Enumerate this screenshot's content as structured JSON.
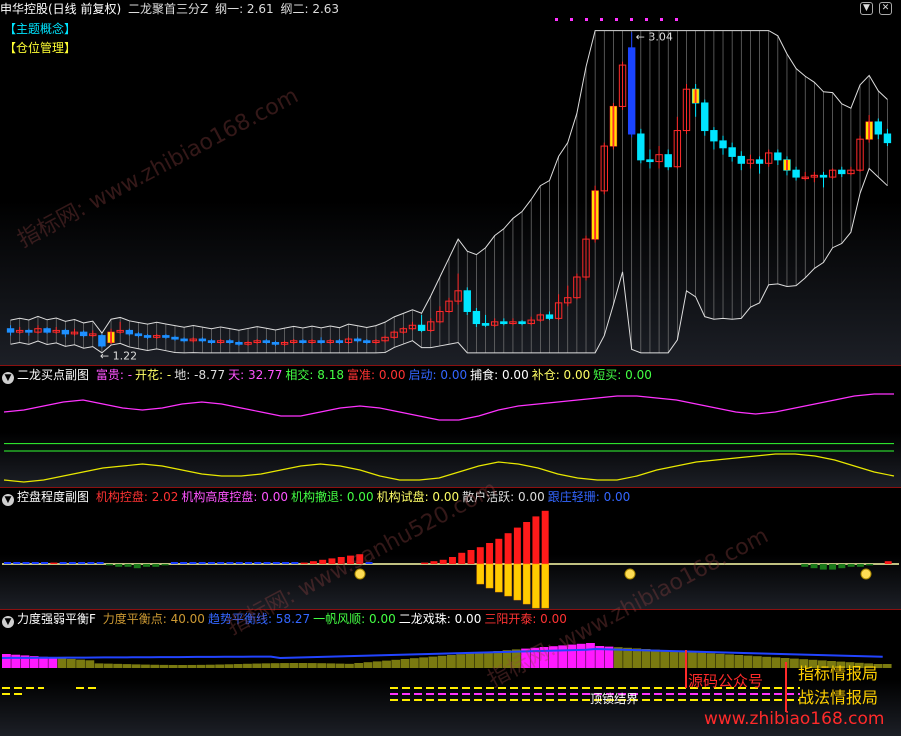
{
  "main": {
    "title": "申华控股(日线 前复权)",
    "indicator": "二龙聚首三分Z",
    "net1_label": "纲一: 2.61",
    "net2_label": "纲二: 2.63",
    "tags": [
      "【主题概念】",
      "【仓位管理】"
    ],
    "high_label": "3.04",
    "low_label": "1.22"
  },
  "p1": {
    "name": "二龙买点副图",
    "items": [
      {
        "label": "富贵: -",
        "color": "#ff55ff"
      },
      {
        "label": "开花: -",
        "color": "#ffff66"
      },
      {
        "label": "地: -8.77",
        "color": "#dddddd"
      },
      {
        "label": "天: 32.77",
        "color": "#ff55ff"
      },
      {
        "label": "相交: 8.18",
        "color": "#44ff44"
      },
      {
        "label": "富准: 0.00",
        "color": "#ff3333"
      },
      {
        "label": "启动: 0.00",
        "color": "#3366ff"
      },
      {
        "label": "捕食: 0.00",
        "color": "#ffffff"
      },
      {
        "label": "补仓: 0.00",
        "color": "#ffff66"
      },
      {
        "label": "短买: 0.00",
        "color": "#44ff44"
      }
    ]
  },
  "p2": {
    "name": "控盘程度副图",
    "items": [
      {
        "label": "机构控盘: 2.02",
        "color": "#ff3333"
      },
      {
        "label": "机构高度控盘: 0.00",
        "color": "#ff55ff"
      },
      {
        "label": "机构撤退: 0.00",
        "color": "#44ff44"
      },
      {
        "label": "机构试盘: 0.00",
        "color": "#ffff66"
      },
      {
        "label": "散户活跃: 0.00",
        "color": "#dddddd"
      },
      {
        "label": "跟庄轻珊: 0.00",
        "color": "#3366ff"
      }
    ]
  },
  "p3": {
    "name": "力度强弱平衡F",
    "items": [
      {
        "label": "力度平衡点: 40.00",
        "color": "#cc9933"
      },
      {
        "label": "趋势平衡线: 58.27",
        "color": "#3366ff"
      },
      {
        "label": "一帆风顺: 0.00",
        "color": "#44ff44"
      },
      {
        "label": "二龙戏珠: 0.00",
        "color": "#ffffff"
      },
      {
        "label": "三阳开泰: 0.00",
        "color": "#ff3333"
      }
    ],
    "signal_text": "顶锁结界",
    "promo1": "指标情报局",
    "promo2": "战法情报局",
    "promo3": "源码公众号",
    "url": "www.zhibiao168.com"
  },
  "watermarks": [
    "指标网: www.zhibiao168.com",
    "指标网: www.sanhu520.com",
    "指标网: www.zhibiao168.com"
  ],
  "chart_data": [
    {
      "type": "candlestick",
      "title": "申华控股(日线 前复权)",
      "note": "price series approximated, prices in yuan",
      "ylim": [
        1.15,
        3.1
      ],
      "candles": [
        [
          1.32,
          1.3,
          1.34,
          1.28
        ],
        [
          1.3,
          1.31,
          1.33,
          1.29
        ],
        [
          1.31,
          1.3,
          1.32,
          1.28
        ],
        [
          1.3,
          1.32,
          1.34,
          1.29
        ],
        [
          1.32,
          1.3,
          1.33,
          1.29
        ],
        [
          1.3,
          1.31,
          1.33,
          1.29
        ],
        [
          1.31,
          1.29,
          1.32,
          1.27
        ],
        [
          1.29,
          1.3,
          1.32,
          1.28
        ],
        [
          1.3,
          1.28,
          1.31,
          1.27
        ],
        [
          1.28,
          1.29,
          1.31,
          1.27
        ],
        [
          1.28,
          1.22,
          1.29,
          1.21
        ],
        [
          1.24,
          1.3,
          1.32,
          1.23
        ],
        [
          1.3,
          1.31,
          1.36,
          1.29
        ],
        [
          1.31,
          1.29,
          1.32,
          1.28
        ],
        [
          1.29,
          1.28,
          1.3,
          1.27
        ],
        [
          1.28,
          1.27,
          1.29,
          1.26
        ],
        [
          1.27,
          1.28,
          1.29,
          1.26
        ],
        [
          1.28,
          1.27,
          1.29,
          1.26
        ],
        [
          1.27,
          1.26,
          1.28,
          1.25
        ],
        [
          1.26,
          1.25,
          1.27,
          1.24
        ],
        [
          1.25,
          1.26,
          1.27,
          1.24
        ],
        [
          1.26,
          1.25,
          1.27,
          1.24
        ],
        [
          1.25,
          1.24,
          1.26,
          1.23
        ],
        [
          1.24,
          1.25,
          1.26,
          1.23
        ],
        [
          1.25,
          1.24,
          1.26,
          1.23
        ],
        [
          1.24,
          1.23,
          1.25,
          1.22
        ],
        [
          1.23,
          1.24,
          1.25,
          1.22
        ],
        [
          1.24,
          1.25,
          1.26,
          1.23
        ],
        [
          1.25,
          1.24,
          1.26,
          1.23
        ],
        [
          1.24,
          1.23,
          1.25,
          1.22
        ],
        [
          1.23,
          1.24,
          1.25,
          1.22
        ],
        [
          1.24,
          1.25,
          1.26,
          1.23
        ],
        [
          1.25,
          1.24,
          1.26,
          1.23
        ],
        [
          1.24,
          1.25,
          1.26,
          1.23
        ],
        [
          1.25,
          1.24,
          1.27,
          1.23
        ],
        [
          1.24,
          1.25,
          1.26,
          1.23
        ],
        [
          1.25,
          1.24,
          1.26,
          1.23
        ],
        [
          1.24,
          1.26,
          1.27,
          1.23
        ],
        [
          1.26,
          1.25,
          1.27,
          1.24
        ],
        [
          1.25,
          1.24,
          1.26,
          1.23
        ],
        [
          1.24,
          1.25,
          1.26,
          1.23
        ],
        [
          1.25,
          1.27,
          1.28,
          1.24
        ],
        [
          1.27,
          1.3,
          1.31,
          1.26
        ],
        [
          1.3,
          1.32,
          1.33,
          1.29
        ],
        [
          1.32,
          1.34,
          1.36,
          1.31
        ],
        [
          1.34,
          1.31,
          1.4,
          1.3
        ],
        [
          1.31,
          1.36,
          1.38,
          1.3
        ],
        [
          1.36,
          1.42,
          1.45,
          1.35
        ],
        [
          1.42,
          1.48,
          1.5,
          1.41
        ],
        [
          1.48,
          1.54,
          1.64,
          1.46
        ],
        [
          1.54,
          1.42,
          1.56,
          1.4
        ],
        [
          1.42,
          1.35,
          1.44,
          1.33
        ],
        [
          1.35,
          1.34,
          1.4,
          1.33
        ],
        [
          1.34,
          1.36,
          1.38,
          1.33
        ],
        [
          1.36,
          1.35,
          1.38,
          1.34
        ],
        [
          1.35,
          1.36,
          1.38,
          1.34
        ],
        [
          1.36,
          1.35,
          1.37,
          1.34
        ],
        [
          1.35,
          1.37,
          1.39,
          1.34
        ],
        [
          1.37,
          1.4,
          1.41,
          1.36
        ],
        [
          1.4,
          1.38,
          1.42,
          1.37
        ],
        [
          1.38,
          1.47,
          1.52,
          1.37
        ],
        [
          1.47,
          1.5,
          1.57,
          1.45
        ],
        [
          1.5,
          1.62,
          1.64,
          1.49
        ],
        [
          1.62,
          1.84,
          1.86,
          1.6
        ],
        [
          1.84,
          2.12,
          2.15,
          1.82
        ],
        [
          2.12,
          2.38,
          2.4,
          2.1
        ],
        [
          2.38,
          2.61,
          2.63,
          2.36
        ],
        [
          2.61,
          2.85,
          2.87,
          2.59
        ],
        [
          2.95,
          2.45,
          3.04,
          2.43
        ],
        [
          2.45,
          2.3,
          2.48,
          2.28
        ],
        [
          2.3,
          2.29,
          2.36,
          2.25
        ],
        [
          2.29,
          2.33,
          2.38,
          2.25
        ],
        [
          2.33,
          2.26,
          2.36,
          2.24
        ],
        [
          2.26,
          2.47,
          2.55,
          2.25
        ],
        [
          2.47,
          2.71,
          2.74,
          2.45
        ],
        [
          2.71,
          2.63,
          2.74,
          2.55
        ],
        [
          2.63,
          2.47,
          2.65,
          2.44
        ],
        [
          2.47,
          2.41,
          2.49,
          2.36
        ],
        [
          2.41,
          2.37,
          2.44,
          2.33
        ],
        [
          2.37,
          2.32,
          2.4,
          2.29
        ],
        [
          2.32,
          2.28,
          2.35,
          2.24
        ],
        [
          2.28,
          2.3,
          2.33,
          2.25
        ],
        [
          2.3,
          2.28,
          2.32,
          2.22
        ],
        [
          2.28,
          2.34,
          2.36,
          2.26
        ],
        [
          2.34,
          2.3,
          2.36,
          2.27
        ],
        [
          2.3,
          2.24,
          2.32,
          2.21
        ],
        [
          2.24,
          2.2,
          2.26,
          2.18
        ],
        [
          2.2,
          2.2,
          2.23,
          2.18
        ],
        [
          2.2,
          2.21,
          2.23,
          2.17
        ],
        [
          2.21,
          2.2,
          2.23,
          2.14
        ],
        [
          2.2,
          2.24,
          2.25,
          2.19
        ],
        [
          2.24,
          2.22,
          2.26,
          2.2
        ],
        [
          2.22,
          2.24,
          2.26,
          2.21
        ],
        [
          2.24,
          2.42,
          2.44,
          2.23
        ],
        [
          2.42,
          2.52,
          2.56,
          2.4
        ],
        [
          2.52,
          2.45,
          2.54,
          2.42
        ],
        [
          2.45,
          2.4,
          2.48,
          2.38
        ]
      ]
    },
    {
      "type": "line",
      "title": "二龙买点副图",
      "series": [
        {
          "name": "天",
          "values": [
            24,
            25,
            27,
            29,
            30,
            28,
            26,
            25,
            26,
            28,
            29,
            28,
            26,
            24,
            22,
            22,
            24,
            26,
            27,
            26,
            24,
            22,
            20,
            20,
            22,
            25,
            27,
            28,
            29,
            30,
            31,
            32,
            32,
            31,
            30,
            28,
            26,
            24,
            23,
            24,
            26,
            28,
            30,
            32,
            33,
            33
          ]
        },
        {
          "name": "地",
          "values": [
            -10,
            -11,
            -10,
            -8,
            -6,
            -4,
            -3,
            -2,
            -3,
            -5,
            -7,
            -8,
            -8,
            -7,
            -5,
            -3,
            -2,
            -3,
            -5,
            -8,
            -10,
            -10,
            -9,
            -6,
            -3,
            -1,
            -2,
            -4,
            -7,
            -9,
            -10,
            -10,
            -8,
            -5,
            -3,
            -1,
            0,
            1,
            2,
            3,
            3,
            2,
            0,
            -3,
            -6,
            -8
          ]
        },
        {
          "name": "相交",
          "values": [
            8.18
          ]
        }
      ]
    },
    {
      "type": "bar",
      "title": "控盘程度副图",
      "series": [
        {
          "name": "机构控盘",
          "values": [
            0,
            0,
            0,
            0,
            0,
            1,
            0,
            0,
            0,
            0,
            0,
            -1,
            -2,
            -2,
            -3,
            -2,
            -2,
            -1,
            0,
            0,
            0,
            0,
            0,
            0,
            0,
            0,
            0,
            0,
            0,
            0,
            0,
            0,
            1,
            2,
            3,
            4,
            5,
            6,
            7,
            0,
            0,
            0,
            0,
            0,
            0,
            1,
            2,
            3,
            5,
            8,
            10,
            12,
            15,
            18,
            22,
            26,
            30,
            34,
            38,
            0,
            0,
            0,
            0,
            0,
            0,
            0,
            0,
            0,
            0,
            0,
            0,
            0,
            0,
            0,
            0,
            0,
            0,
            0,
            0,
            0,
            0,
            0,
            0,
            0,
            0,
            0,
            -2,
            -3,
            -4,
            -4,
            -3,
            -2,
            -2,
            -1,
            0,
            2
          ]
        },
        {
          "name": "机构试盘",
          "values": [
            0,
            0,
            0,
            0,
            0,
            0,
            0,
            0,
            0,
            0,
            0,
            0,
            0,
            0,
            0,
            0,
            0,
            0,
            0,
            0,
            0,
            0,
            0,
            0,
            0,
            0,
            0,
            0,
            0,
            0,
            0,
            0,
            0,
            0,
            0,
            0,
            0,
            0,
            0,
            0,
            0,
            0,
            0,
            0,
            0,
            0,
            0,
            0,
            0,
            0,
            0,
            -10,
            -12,
            -14,
            -16,
            -18,
            -20,
            -22,
            -22,
            0,
            0,
            0,
            0,
            0,
            0,
            0,
            0,
            0,
            0,
            0,
            0,
            0,
            0,
            0,
            0,
            0,
            0,
            0,
            0,
            0,
            0,
            0,
            0,
            0,
            0,
            0,
            0,
            0,
            0,
            0,
            0,
            0,
            0,
            0,
            0,
            0
          ]
        }
      ]
    },
    {
      "type": "bar",
      "title": "力度强弱平衡F",
      "series": [
        {
          "name": "力度平衡点",
          "values": [
            40
          ]
        },
        {
          "name": "趋势平衡线",
          "values": [
            58.27
          ]
        }
      ]
    }
  ]
}
